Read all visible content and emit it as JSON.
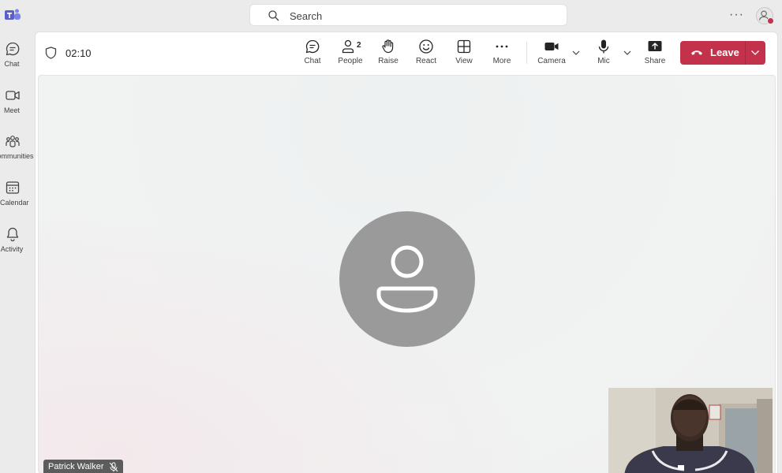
{
  "app": {
    "name": "Microsoft Teams"
  },
  "search": {
    "placeholder": "Search"
  },
  "rail": {
    "items": [
      {
        "label": "Chat",
        "icon": "chat-icon"
      },
      {
        "label": "Meet",
        "icon": "video-camera-icon"
      },
      {
        "label": "Communities",
        "icon": "communities-icon"
      },
      {
        "label": "Calendar",
        "icon": "calendar-icon"
      },
      {
        "label": "Activity",
        "icon": "bell-icon"
      }
    ]
  },
  "meeting": {
    "timer": "02:10",
    "toolbar": {
      "chat": "Chat",
      "people": "People",
      "people_count": "2",
      "raise": "Raise",
      "react": "React",
      "view": "View",
      "more": "More",
      "camera": "Camera",
      "mic": "Mic",
      "share": "Share",
      "leave": "Leave"
    },
    "participant": {
      "name": "Patrick Walker",
      "muted": true
    },
    "colors": {
      "leave": "#c4314b",
      "avatar": "#9a9a9a",
      "brand": "#5b5fc7"
    }
  }
}
